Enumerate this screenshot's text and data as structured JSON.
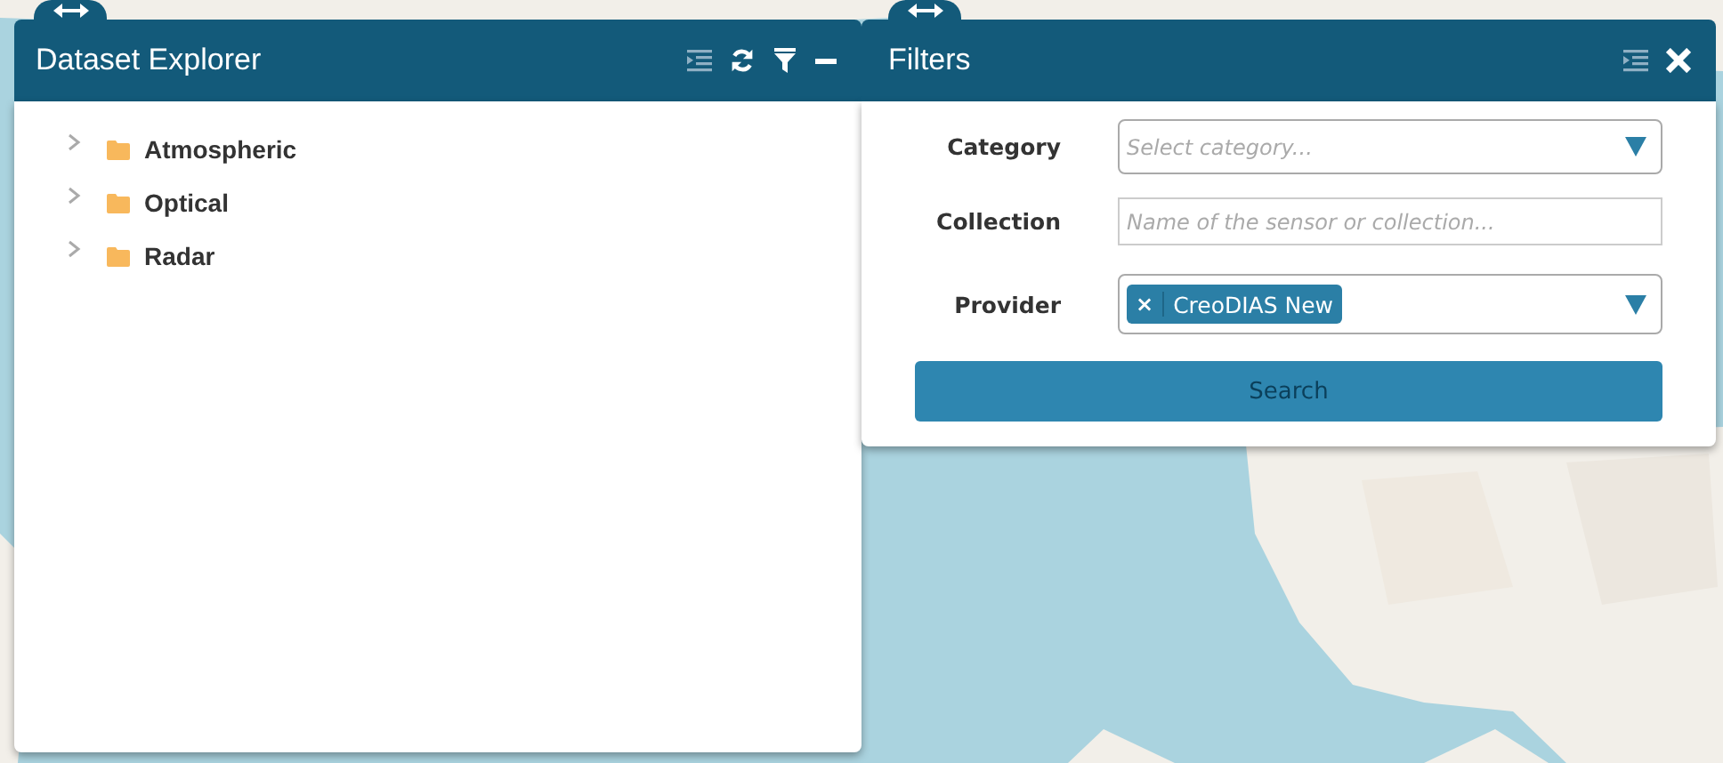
{
  "dataset_explorer": {
    "title": "Dataset Explorer",
    "tree": [
      {
        "label": "Atmospheric",
        "expanded": false
      },
      {
        "label": "Optical",
        "expanded": false
      },
      {
        "label": "Radar",
        "expanded": false
      }
    ]
  },
  "filters": {
    "title": "Filters",
    "fields": [
      {
        "kind": "select",
        "label": "Category",
        "placeholder": "Select category..."
      },
      {
        "kind": "text",
        "label": "Collection",
        "placeholder": "Name of the sensor or collection..."
      },
      {
        "kind": "tags",
        "label": "Provider",
        "tags": [
          "CreoDIAS New"
        ],
        "remove": "×"
      }
    ],
    "search_button": {
      "label": "Search",
      "disabled": true
    }
  }
}
